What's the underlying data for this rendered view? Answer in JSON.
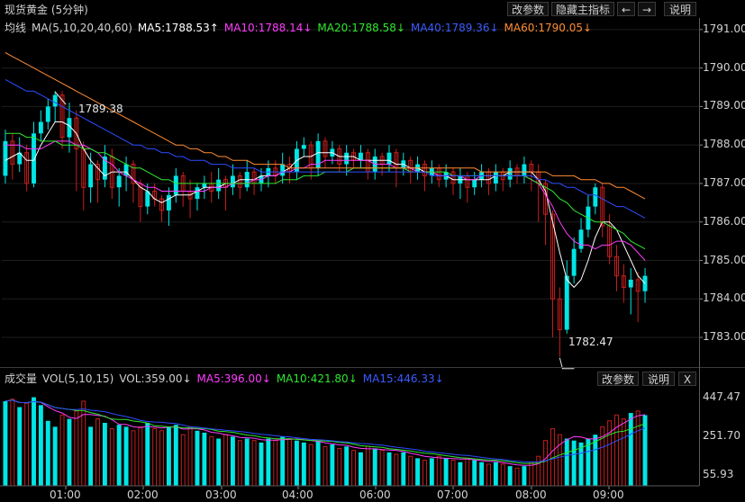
{
  "window": {
    "title": "现货黄金 (5分钟)"
  },
  "toolbar": {
    "params": "改参数",
    "hide_main": "隐藏主指标",
    "left_arrow": "←",
    "right_arrow": "→",
    "help": "说明"
  },
  "price_legend": {
    "label": "均线",
    "ma_name": "MA(5,10,20,40,60)",
    "ma5": "MA5:1788.53↑",
    "ma10": "MA10:1788.14↓",
    "ma20": "MA20:1788.58↓",
    "ma40": "MA40:1789.36↓",
    "ma60": "MA60:1790.05↓"
  },
  "vol_legend": {
    "label": "成交量",
    "vol_name": "VOL(5,10,15)",
    "vol": "VOL:359.00↓",
    "ma5": "MA5:396.00↓",
    "ma10": "MA10:421.80↓",
    "ma15": "MA15:446.33↓"
  },
  "vol_toolbar": {
    "params": "改参数",
    "help": "说明",
    "close": "X"
  },
  "annotations": {
    "high": "1789.38",
    "low": "1782.47"
  },
  "price_axis": [
    "1791.00",
    "1790.00",
    "1789.00",
    "1788.00",
    "1787.00",
    "1786.00",
    "1785.00",
    "1784.00",
    "1783.00"
  ],
  "volume_axis": [
    "447.47",
    "251.70",
    "55.93"
  ],
  "time_axis": [
    "01:00",
    "02:00",
    "03:00",
    "04:00",
    "06:00",
    "07:00",
    "08:00",
    "09:00"
  ],
  "colors": {
    "up": "#00e5e5",
    "down": "#c81e1e",
    "ma5": "#ffffff",
    "ma10": "#ff3cff",
    "ma20": "#2ee82e",
    "ma40": "#2c4cff",
    "ma60": "#ff8c33"
  },
  "chart_data": {
    "type": "candlestick",
    "price_ylim": [
      1782.3,
      1791.3
    ],
    "volume_ylim": [
      0,
      480
    ],
    "high_label": 1789.38,
    "low_label": 1782.47,
    "candles": [
      [
        1787.2,
        1788.1,
        1788.4,
        1787.0,
        430
      ],
      [
        1788.1,
        1787.5,
        1788.3,
        1787.1,
        440
      ],
      [
        1787.5,
        1787.8,
        1788.2,
        1787.3,
        400
      ],
      [
        1787.8,
        1787.0,
        1788.0,
        1786.8,
        420
      ],
      [
        1787.0,
        1788.3,
        1788.6,
        1786.9,
        450
      ],
      [
        1788.3,
        1788.6,
        1788.9,
        1788.1,
        410
      ],
      [
        1788.6,
        1789.0,
        1789.2,
        1788.4,
        330
      ],
      [
        1789.0,
        1789.3,
        1789.4,
        1788.6,
        300
      ],
      [
        1789.3,
        1788.2,
        1789.4,
        1787.9,
        360
      ],
      [
        1788.2,
        1788.7,
        1789.1,
        1787.8,
        340
      ],
      [
        1788.7,
        1787.9,
        1788.9,
        1786.8,
        380
      ],
      [
        1787.9,
        1786.9,
        1788.1,
        1786.3,
        430
      ],
      [
        1786.9,
        1787.5,
        1787.8,
        1786.5,
        300
      ],
      [
        1787.5,
        1787.1,
        1787.6,
        1786.5,
        340
      ],
      [
        1787.1,
        1787.7,
        1788.0,
        1786.9,
        320
      ],
      [
        1787.7,
        1786.9,
        1787.9,
        1786.6,
        290
      ],
      [
        1786.9,
        1787.2,
        1787.4,
        1786.4,
        310
      ],
      [
        1787.2,
        1787.5,
        1787.7,
        1786.8,
        300
      ],
      [
        1787.5,
        1787.0,
        1787.6,
        1786.5,
        280
      ],
      [
        1787.0,
        1786.4,
        1787.1,
        1786.0,
        300
      ],
      [
        1786.4,
        1786.8,
        1787.0,
        1786.2,
        320
      ],
      [
        1786.8,
        1786.6,
        1787.0,
        1786.4,
        290
      ],
      [
        1786.6,
        1786.3,
        1786.7,
        1786.0,
        280
      ],
      [
        1786.3,
        1786.7,
        1786.9,
        1785.9,
        300
      ],
      [
        1786.7,
        1787.2,
        1787.4,
        1786.5,
        310
      ],
      [
        1787.2,
        1786.8,
        1787.3,
        1786.4,
        260
      ],
      [
        1786.8,
        1786.6,
        1787.1,
        1786.1,
        300
      ],
      [
        1786.6,
        1786.9,
        1787.0,
        1786.3,
        280
      ],
      [
        1786.9,
        1787.0,
        1787.2,
        1786.6,
        270
      ],
      [
        1787.0,
        1786.8,
        1787.3,
        1786.5,
        250
      ],
      [
        1786.8,
        1787.1,
        1787.4,
        1786.6,
        240
      ],
      [
        1787.1,
        1786.9,
        1787.2,
        1786.3,
        260
      ],
      [
        1786.9,
        1787.2,
        1787.5,
        1786.7,
        250
      ],
      [
        1787.2,
        1786.9,
        1787.3,
        1786.6,
        230
      ],
      [
        1786.9,
        1787.3,
        1787.6,
        1786.8,
        240
      ],
      [
        1787.3,
        1787.0,
        1787.4,
        1786.7,
        230
      ],
      [
        1787.0,
        1787.2,
        1787.4,
        1786.8,
        220
      ],
      [
        1787.2,
        1787.4,
        1787.6,
        1786.9,
        240
      ],
      [
        1787.4,
        1787.2,
        1787.6,
        1787.0,
        230
      ],
      [
        1787.2,
        1787.5,
        1787.8,
        1787.0,
        250
      ],
      [
        1787.5,
        1787.3,
        1787.7,
        1787.0,
        240
      ],
      [
        1787.3,
        1787.9,
        1788.1,
        1787.1,
        230
      ],
      [
        1787.9,
        1788.0,
        1788.2,
        1787.7,
        220
      ],
      [
        1788.0,
        1787.4,
        1788.1,
        1787.1,
        210
      ],
      [
        1787.4,
        1788.1,
        1788.3,
        1787.2,
        230
      ],
      [
        1788.1,
        1787.7,
        1788.2,
        1787.4,
        200
      ],
      [
        1787.7,
        1787.9,
        1788.1,
        1787.5,
        210
      ],
      [
        1787.9,
        1787.5,
        1788.0,
        1787.3,
        190
      ],
      [
        1787.5,
        1787.8,
        1788.0,
        1787.2,
        200
      ],
      [
        1787.8,
        1787.6,
        1787.9,
        1787.4,
        180
      ],
      [
        1787.6,
        1787.8,
        1788.0,
        1787.4,
        170
      ],
      [
        1787.8,
        1787.3,
        1787.9,
        1787.1,
        200
      ],
      [
        1787.3,
        1787.7,
        1787.9,
        1787.1,
        190
      ],
      [
        1787.7,
        1787.5,
        1787.8,
        1787.2,
        180
      ],
      [
        1787.5,
        1787.8,
        1788.0,
        1787.3,
        170
      ],
      [
        1787.8,
        1787.4,
        1787.9,
        1786.9,
        160
      ],
      [
        1787.4,
        1787.6,
        1787.8,
        1787.2,
        170
      ],
      [
        1787.6,
        1787.3,
        1787.7,
        1787.0,
        150
      ],
      [
        1787.3,
        1787.5,
        1787.7,
        1787.1,
        140
      ],
      [
        1787.5,
        1787.2,
        1787.6,
        1786.8,
        130
      ],
      [
        1787.2,
        1787.4,
        1787.6,
        1787.0,
        140
      ],
      [
        1787.4,
        1787.1,
        1787.5,
        1786.9,
        150
      ],
      [
        1787.1,
        1787.3,
        1787.5,
        1786.9,
        140
      ],
      [
        1787.3,
        1787.0,
        1787.4,
        1786.7,
        130
      ],
      [
        1787.0,
        1787.2,
        1787.4,
        1786.6,
        120
      ],
      [
        1787.2,
        1786.9,
        1787.3,
        1786.5,
        140
      ],
      [
        1786.9,
        1787.1,
        1787.3,
        1786.7,
        130
      ],
      [
        1787.1,
        1787.3,
        1787.5,
        1786.9,
        120
      ],
      [
        1787.3,
        1787.0,
        1787.4,
        1786.7,
        110
      ],
      [
        1787.0,
        1787.3,
        1787.5,
        1786.8,
        120
      ],
      [
        1787.3,
        1787.1,
        1787.4,
        1786.8,
        110
      ],
      [
        1787.1,
        1787.4,
        1787.6,
        1786.9,
        100
      ],
      [
        1787.4,
        1787.2,
        1787.5,
        1787.0,
        90
      ],
      [
        1787.2,
        1787.5,
        1787.7,
        1787.0,
        100
      ],
      [
        1787.5,
        1787.3,
        1787.6,
        1786.8,
        120
      ],
      [
        1787.3,
        1787.0,
        1787.5,
        1786.0,
        150
      ],
      [
        1787.0,
        1786.2,
        1787.1,
        1785.4,
        230
      ],
      [
        1786.2,
        1784.0,
        1786.3,
        1783.0,
        290
      ],
      [
        1784.0,
        1783.2,
        1784.3,
        1782.5,
        260
      ],
      [
        1783.2,
        1784.6,
        1785.0,
        1783.1,
        240
      ],
      [
        1784.6,
        1785.3,
        1785.6,
        1784.4,
        230
      ],
      [
        1785.3,
        1785.8,
        1786.1,
        1785.2,
        220
      ],
      [
        1785.8,
        1786.4,
        1786.7,
        1785.6,
        240
      ],
      [
        1786.4,
        1786.9,
        1787.0,
        1786.2,
        260
      ],
      [
        1786.9,
        1785.9,
        1787.0,
        1785.6,
        300
      ],
      [
        1785.9,
        1785.1,
        1786.2,
        1784.9,
        330
      ],
      [
        1785.1,
        1784.6,
        1785.4,
        1784.2,
        360
      ],
      [
        1784.6,
        1784.3,
        1784.9,
        1783.9,
        340
      ],
      [
        1784.3,
        1784.5,
        1784.8,
        1783.6,
        370
      ],
      [
        1784.5,
        1784.2,
        1784.7,
        1783.4,
        380
      ],
      [
        1784.2,
        1784.6,
        1784.8,
        1783.9,
        359
      ]
    ],
    "series": [
      {
        "name": "MA5",
        "values": [
          1787.6,
          1787.7,
          1787.8,
          1787.6,
          1787.6,
          1788.0,
          1788.3,
          1788.6,
          1788.6,
          1788.5,
          1788.3,
          1787.9,
          1787.6,
          1787.4,
          1787.2,
          1787.3,
          1787.3,
          1787.3,
          1787.1,
          1786.9,
          1786.8,
          1786.6,
          1786.5,
          1786.6,
          1786.7,
          1786.7,
          1786.7,
          1786.8,
          1786.9,
          1786.9,
          1786.9,
          1787.0,
          1787.0,
          1787.1,
          1787.1,
          1787.1,
          1787.2,
          1787.2,
          1787.2,
          1787.3,
          1787.4,
          1787.6,
          1787.7,
          1787.7,
          1787.8,
          1787.8,
          1787.8,
          1787.7,
          1787.7,
          1787.7,
          1787.6,
          1787.6,
          1787.6,
          1787.6,
          1787.6,
          1787.5,
          1787.5,
          1787.4,
          1787.4,
          1787.3,
          1787.3,
          1787.2,
          1787.2,
          1787.1,
          1787.1,
          1787.1,
          1787.1,
          1787.1,
          1787.1,
          1787.2,
          1787.2,
          1787.3,
          1787.3,
          1787.3,
          1787.3,
          1787.1,
          1786.8,
          1786.0,
          1785.2,
          1784.5,
          1784.3,
          1784.5,
          1785.0,
          1785.6,
          1786.0,
          1786.0,
          1785.8,
          1785.4,
          1785.0,
          1784.6,
          1784.4
        ]
      },
      {
        "name": "MA10",
        "values": [
          1788.0,
          1788.0,
          1788.0,
          1787.9,
          1787.9,
          1787.9,
          1788.0,
          1788.1,
          1788.1,
          1788.1,
          1788.0,
          1788.0,
          1787.9,
          1787.8,
          1787.6,
          1787.5,
          1787.3,
          1787.2,
          1787.1,
          1787.0,
          1786.9,
          1786.9,
          1786.8,
          1786.8,
          1786.8,
          1786.8,
          1786.8,
          1786.8,
          1786.8,
          1786.9,
          1786.9,
          1786.9,
          1787.0,
          1787.0,
          1787.0,
          1787.1,
          1787.1,
          1787.2,
          1787.2,
          1787.3,
          1787.3,
          1787.4,
          1787.4,
          1787.5,
          1787.5,
          1787.6,
          1787.6,
          1787.6,
          1787.6,
          1787.6,
          1787.6,
          1787.6,
          1787.5,
          1787.5,
          1787.5,
          1787.4,
          1787.4,
          1787.4,
          1787.3,
          1787.3,
          1787.3,
          1787.2,
          1787.2,
          1787.2,
          1787.2,
          1787.1,
          1787.1,
          1787.2,
          1787.2,
          1787.2,
          1787.2,
          1787.2,
          1787.2,
          1787.2,
          1787.1,
          1787.0,
          1786.7,
          1786.4,
          1786.0,
          1785.7,
          1785.5,
          1785.4,
          1785.4,
          1785.3,
          1785.4,
          1785.4,
          1785.5,
          1785.5,
          1785.4,
          1785.2,
          1785.0
        ]
      },
      {
        "name": "MA20",
        "values": [
          1788.3,
          1788.3,
          1788.3,
          1788.2,
          1788.2,
          1788.1,
          1788.1,
          1788.1,
          1788.0,
          1788.0,
          1788.0,
          1787.9,
          1787.9,
          1787.8,
          1787.8,
          1787.7,
          1787.6,
          1787.5,
          1787.4,
          1787.4,
          1787.3,
          1787.2,
          1787.1,
          1787.1,
          1787.0,
          1787.0,
          1787.0,
          1787.0,
          1787.0,
          1787.0,
          1787.0,
          1787.0,
          1787.0,
          1787.0,
          1787.0,
          1787.0,
          1787.0,
          1787.0,
          1787.0,
          1787.1,
          1787.1,
          1787.1,
          1787.2,
          1787.2,
          1787.2,
          1787.3,
          1787.3,
          1787.3,
          1787.3,
          1787.4,
          1787.4,
          1787.4,
          1787.4,
          1787.4,
          1787.4,
          1787.4,
          1787.4,
          1787.3,
          1787.3,
          1787.3,
          1787.3,
          1787.3,
          1787.3,
          1787.2,
          1787.2,
          1787.2,
          1787.2,
          1787.2,
          1787.2,
          1787.2,
          1787.2,
          1787.2,
          1787.2,
          1787.2,
          1787.1,
          1787.0,
          1786.9,
          1786.8,
          1786.6,
          1786.5,
          1786.3,
          1786.2,
          1786.1,
          1786.0,
          1786.0,
          1785.9,
          1785.8,
          1785.7,
          1785.5,
          1785.4,
          1785.3
        ]
      },
      {
        "name": "MA40",
        "values": [
          1789.7,
          1789.6,
          1789.5,
          1789.4,
          1789.4,
          1789.3,
          1789.2,
          1789.1,
          1789.0,
          1788.9,
          1788.8,
          1788.7,
          1788.6,
          1788.5,
          1788.4,
          1788.3,
          1788.2,
          1788.1,
          1788.0,
          1788.0,
          1787.9,
          1787.9,
          1787.8,
          1787.8,
          1787.7,
          1787.7,
          1787.6,
          1787.6,
          1787.6,
          1787.5,
          1787.5,
          1787.5,
          1787.4,
          1787.4,
          1787.4,
          1787.4,
          1787.3,
          1787.3,
          1787.3,
          1787.3,
          1787.3,
          1787.3,
          1787.3,
          1787.3,
          1787.3,
          1787.3,
          1787.3,
          1787.3,
          1787.3,
          1787.3,
          1787.3,
          1787.3,
          1787.3,
          1787.3,
          1787.3,
          1787.3,
          1787.3,
          1787.3,
          1787.3,
          1787.3,
          1787.2,
          1787.2,
          1787.2,
          1787.2,
          1787.2,
          1787.2,
          1787.2,
          1787.2,
          1787.2,
          1787.2,
          1787.2,
          1787.2,
          1787.2,
          1787.2,
          1787.2,
          1787.1,
          1787.1,
          1787.0,
          1787.0,
          1786.9,
          1786.9,
          1786.8,
          1786.7,
          1786.7,
          1786.6,
          1786.5,
          1786.4,
          1786.4,
          1786.3,
          1786.2,
          1786.1
        ]
      },
      {
        "name": "MA60",
        "values": [
          1790.4,
          1790.3,
          1790.2,
          1790.1,
          1790.0,
          1789.9,
          1789.8,
          1789.7,
          1789.6,
          1789.5,
          1789.4,
          1789.3,
          1789.2,
          1789.1,
          1789.0,
          1788.9,
          1788.8,
          1788.7,
          1788.6,
          1788.5,
          1788.4,
          1788.3,
          1788.2,
          1788.1,
          1788.0,
          1788.0,
          1787.9,
          1787.9,
          1787.8,
          1787.8,
          1787.7,
          1787.7,
          1787.6,
          1787.6,
          1787.6,
          1787.5,
          1787.5,
          1787.5,
          1787.5,
          1787.5,
          1787.4,
          1787.4,
          1787.4,
          1787.4,
          1787.4,
          1787.4,
          1787.4,
          1787.4,
          1787.4,
          1787.4,
          1787.4,
          1787.4,
          1787.4,
          1787.4,
          1787.4,
          1787.4,
          1787.4,
          1787.4,
          1787.4,
          1787.4,
          1787.4,
          1787.4,
          1787.4,
          1787.4,
          1787.4,
          1787.4,
          1787.4,
          1787.3,
          1787.3,
          1787.3,
          1787.3,
          1787.3,
          1787.3,
          1787.3,
          1787.3,
          1787.3,
          1787.3,
          1787.2,
          1787.2,
          1787.2,
          1787.2,
          1787.1,
          1787.1,
          1787.1,
          1787.0,
          1787.0,
          1786.9,
          1786.9,
          1786.8,
          1786.7,
          1786.6
        ]
      }
    ]
  }
}
